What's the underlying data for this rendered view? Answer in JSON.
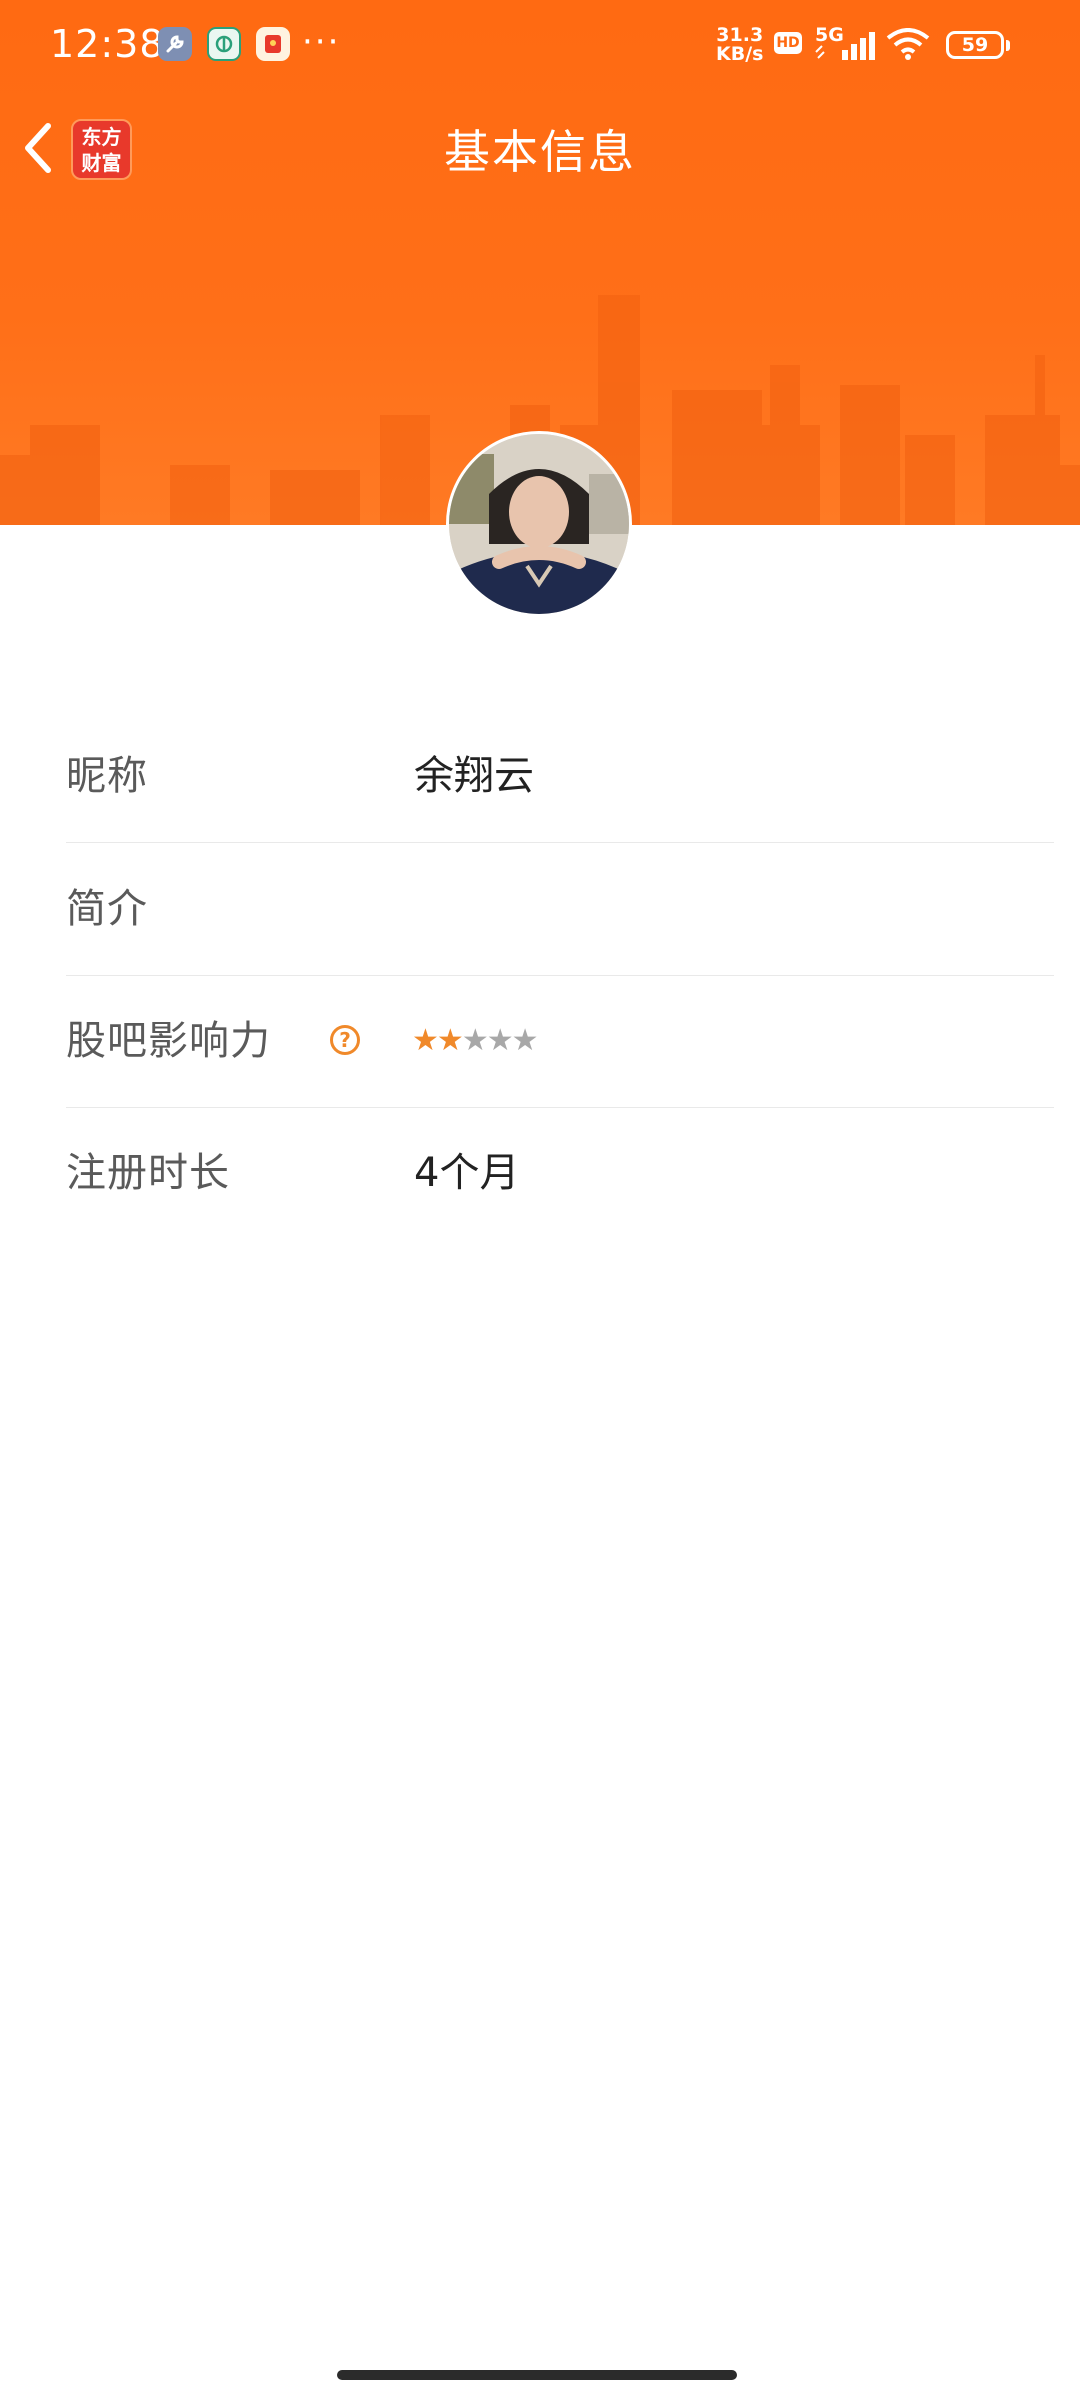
{
  "status_bar": {
    "time": "12:38",
    "net_speed_value": "31.3",
    "net_speed_unit": "KB/s",
    "hd": "HD",
    "network": "5G",
    "battery": "59",
    "overflow": "···"
  },
  "nav": {
    "title": "基本信息",
    "brand_line1": "东方",
    "brand_line2": "财富"
  },
  "profile": {
    "rows": [
      {
        "label": "昵称",
        "value": "余翔云"
      },
      {
        "label": "简介",
        "value": ""
      },
      {
        "label": "股吧影响力",
        "help": "?",
        "rating": 2,
        "rating_max": 5
      },
      {
        "label": "注册时长",
        "value": "4个月"
      }
    ]
  },
  "colors": {
    "accent": "#ff6a12",
    "star_active": "#f0892a",
    "star_inactive": "#a8a8a8"
  }
}
